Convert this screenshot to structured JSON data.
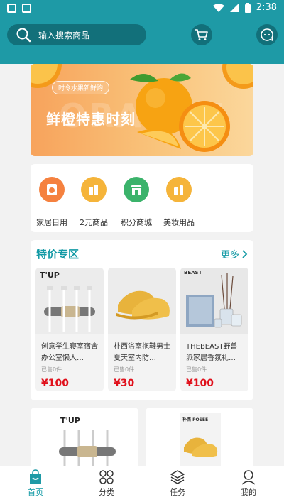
{
  "status_bar": {
    "time": "2:38"
  },
  "search": {
    "placeholder": "输入搜索商品"
  },
  "banner": {
    "tag": "时令水果新鲜购",
    "title": "鲜橙特惠时刻",
    "ghost_text": "ORANGE"
  },
  "categories": [
    {
      "label": "家居日用",
      "icon": "washing-machine-icon",
      "color": "#f5813f"
    },
    {
      "label": "2元商品",
      "icon": "bottle-icon",
      "color": "#f5b43a"
    },
    {
      "label": "积分商城",
      "icon": "shop-icon",
      "color": "#3bb36b"
    },
    {
      "label": "美妆用品",
      "icon": "cosmetics-icon",
      "color": "#f5b43a"
    }
  ],
  "special": {
    "title": "特价专区",
    "more": "更多",
    "products": [
      {
        "name": "创意学生寝室宿舍办公室懒人…",
        "sold": "已售0件",
        "price": "¥100",
        "brand": "T'UP"
      },
      {
        "name": "朴西浴室拖鞋男士夏天室内防…",
        "sold": "已售0件",
        "price": "¥30",
        "brand": ""
      },
      {
        "name": "THEBEAST野兽派家居香氛礼…",
        "sold": "已售0件",
        "price": "¥100",
        "brand": "BEAST"
      }
    ]
  },
  "lower_products": [
    {
      "brand": "T'UP"
    },
    {
      "brand": "朴西 POSEE"
    }
  ],
  "bottom_nav": [
    {
      "label": "首页",
      "icon": "home-bag-icon",
      "active": true
    },
    {
      "label": "分类",
      "icon": "category-grid-icon",
      "active": false
    },
    {
      "label": "任务",
      "icon": "layers-icon",
      "active": false
    },
    {
      "label": "我的",
      "icon": "user-icon",
      "active": false
    }
  ],
  "colors": {
    "accent": "#1e9aa6",
    "price": "#e0101b"
  }
}
